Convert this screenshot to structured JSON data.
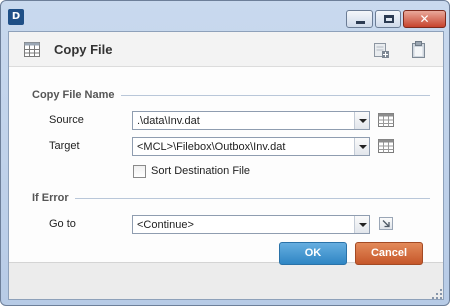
{
  "window": {
    "app_icon_text": "D",
    "controls": {
      "minimize": "minimize",
      "maximize": "maximize",
      "close": "✕"
    }
  },
  "header": {
    "title": "Copy File",
    "icons": [
      "table-icon",
      "add-step-icon",
      "clipboard-icon"
    ]
  },
  "copy_section": {
    "label": "Copy File Name",
    "source_label": "Source",
    "source_value": ".\\data\\Inv.dat",
    "target_label": "Target",
    "target_value": "<MCL>\\Filebox\\Outbox\\Inv.dat",
    "sort_label": "Sort Destination File",
    "sort_checked": false
  },
  "error_section": {
    "label": "If Error",
    "goto_label": "Go to",
    "goto_value": "<Continue>"
  },
  "buttons": {
    "ok": "OK",
    "cancel": "Cancel"
  },
  "colors": {
    "ok": "#3c90cf",
    "cancel": "#d2693a",
    "title_bar": "#c3d5ec"
  }
}
